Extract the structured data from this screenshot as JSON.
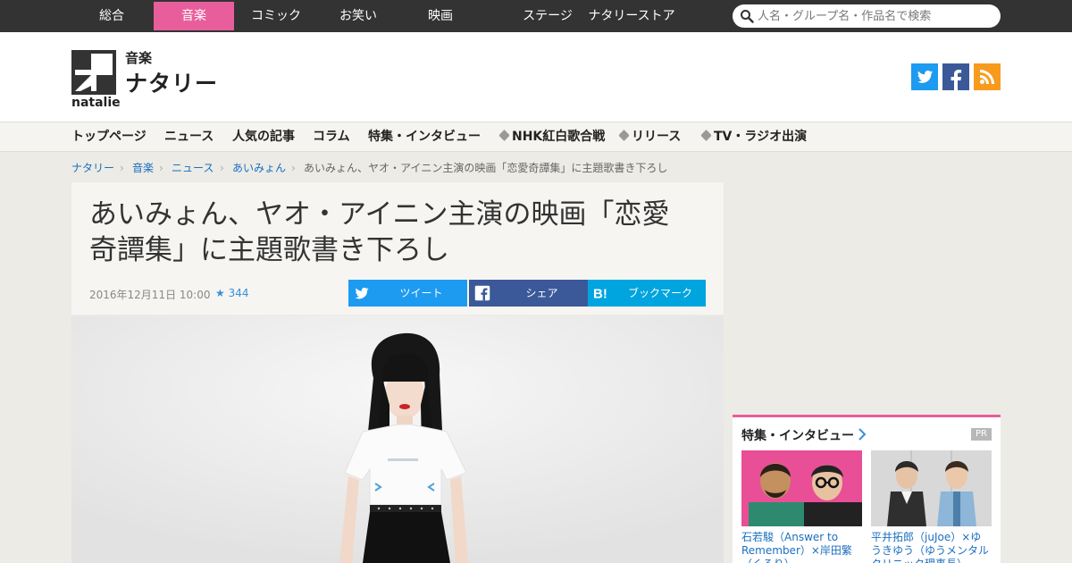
{
  "top_nav": {
    "tabs": [
      {
        "label": "総合",
        "active": false
      },
      {
        "label": "音楽",
        "active": true
      },
      {
        "label": "コミック",
        "active": false
      },
      {
        "label": "お笑い",
        "active": false
      },
      {
        "label": "映画",
        "active": false
      },
      {
        "label": "ステージ",
        "active": false
      },
      {
        "label": "ナタリーストア",
        "active": false
      }
    ],
    "search_placeholder": "人名・グループ名・作品名で検索"
  },
  "logo": {
    "category": "音楽",
    "name": "ナタリー",
    "roman": "natalie"
  },
  "social_icons": [
    "twitter-icon",
    "facebook-icon",
    "rss-icon"
  ],
  "sub_nav": {
    "items": [
      {
        "label": "トップページ",
        "tag": false
      },
      {
        "label": "ニュース",
        "tag": false
      },
      {
        "label": "人気の記事",
        "tag": false
      },
      {
        "label": "コラム",
        "tag": false
      },
      {
        "label": "特集・インタビュー",
        "tag": false
      },
      {
        "label": "NHK紅白歌合戦",
        "tag": true
      },
      {
        "label": "リリース",
        "tag": true
      },
      {
        "label": "TV・ラジオ出演",
        "tag": true
      }
    ]
  },
  "breadcrumb": {
    "items": [
      "ナタリー",
      "音楽",
      "ニュース",
      "あいみょん"
    ],
    "current": "あいみょん、ヤオ・アイニン主演の映画「恋愛奇譚集」に主題歌書き下ろし"
  },
  "article": {
    "title_line1": "あいみょん、ヤオ・アイニン主演の映画「恋愛",
    "title_line2": "奇譚集」に主題歌書き下ろし",
    "date": "2016年12月11日 10:00",
    "favorites": "344",
    "share_buttons": [
      {
        "label": "ツイート",
        "color": "#1d9bf0",
        "icon": "twitter-icon"
      },
      {
        "label": "シェア",
        "color": "#3b5998",
        "icon": "facebook-icon"
      },
      {
        "label": "ブックマーク",
        "color": "#00a4de",
        "icon": "hatena-bookmark-icon"
      }
    ]
  },
  "sidebar": {
    "title": "特集・インタビュー",
    "pr_label": "PR",
    "cards": [
      {
        "caption": "石若駿（Answer to Remember）×岸田繁（くるり）"
      },
      {
        "caption": "平井拓郎（juJoe）×ゆうきゆう（ゆうメンタルクリニック理事長）"
      }
    ]
  },
  "colors": {
    "accent_pink": "#e85e9c",
    "top_nav_bg": "#333333",
    "link_blue": "#1b6fbf",
    "twitter": "#1d9bf0",
    "facebook": "#3b5998",
    "rss": "#f89a1c"
  }
}
